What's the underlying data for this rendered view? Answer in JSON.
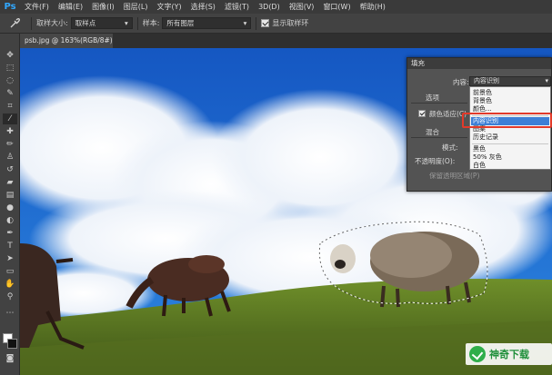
{
  "app": {
    "logo_text": "Ps"
  },
  "menu": [
    "文件(F)",
    "编辑(E)",
    "图像(I)",
    "图层(L)",
    "文字(Y)",
    "选择(S)",
    "滤镜(T)",
    "3D(D)",
    "视图(V)",
    "窗口(W)",
    "帮助(H)"
  ],
  "options_bar": {
    "tool_icon": "eyedropper-icon",
    "sample_size_label": "取样大小:",
    "sample_size_value": "取样点",
    "sample_label": "样本:",
    "sample_value": "所有图层",
    "show_ring_label": "显示取样环",
    "show_ring_checked": true
  },
  "tools": [
    "move-icon",
    "marquee-icon",
    "lasso-icon",
    "quick-select-icon",
    "crop-icon",
    "eyedropper-icon",
    "healing-brush-icon",
    "brush-icon",
    "clone-stamp-icon",
    "history-brush-icon",
    "eraser-icon",
    "gradient-icon",
    "blur-icon",
    "dodge-icon",
    "pen-icon",
    "type-icon",
    "path-select-icon",
    "shape-icon",
    "hand-icon",
    "zoom-icon",
    "color-swatch-icon"
  ],
  "document_tab": {
    "label": "psb.jpg @ 163%(RGB/8#) *"
  },
  "fill_dialog": {
    "title": "填充",
    "content_label": "内容:",
    "content_value": "内容识别",
    "options_label": "选项",
    "color_adapt_label": "颜色适应(C)",
    "color_adapt_checked": true,
    "blend_label": "混合",
    "mode_label": "模式:",
    "opacity_label": "不透明度(O):",
    "preserve_label": "保留透明区域(P)"
  },
  "content_dropdown": {
    "items": [
      "前景色",
      "背景色",
      "颜色...",
      "内容识别",
      "图案",
      "历史记录",
      "黑色",
      "50% 灰色",
      "白色"
    ],
    "selected": "内容识别"
  },
  "watermark": {
    "text": "神奇下载"
  },
  "colors": {
    "accent": "#31a8ff",
    "selection": "#3d7fd6",
    "highlight": "#e23a2a",
    "sky": "#1d6fd6"
  }
}
